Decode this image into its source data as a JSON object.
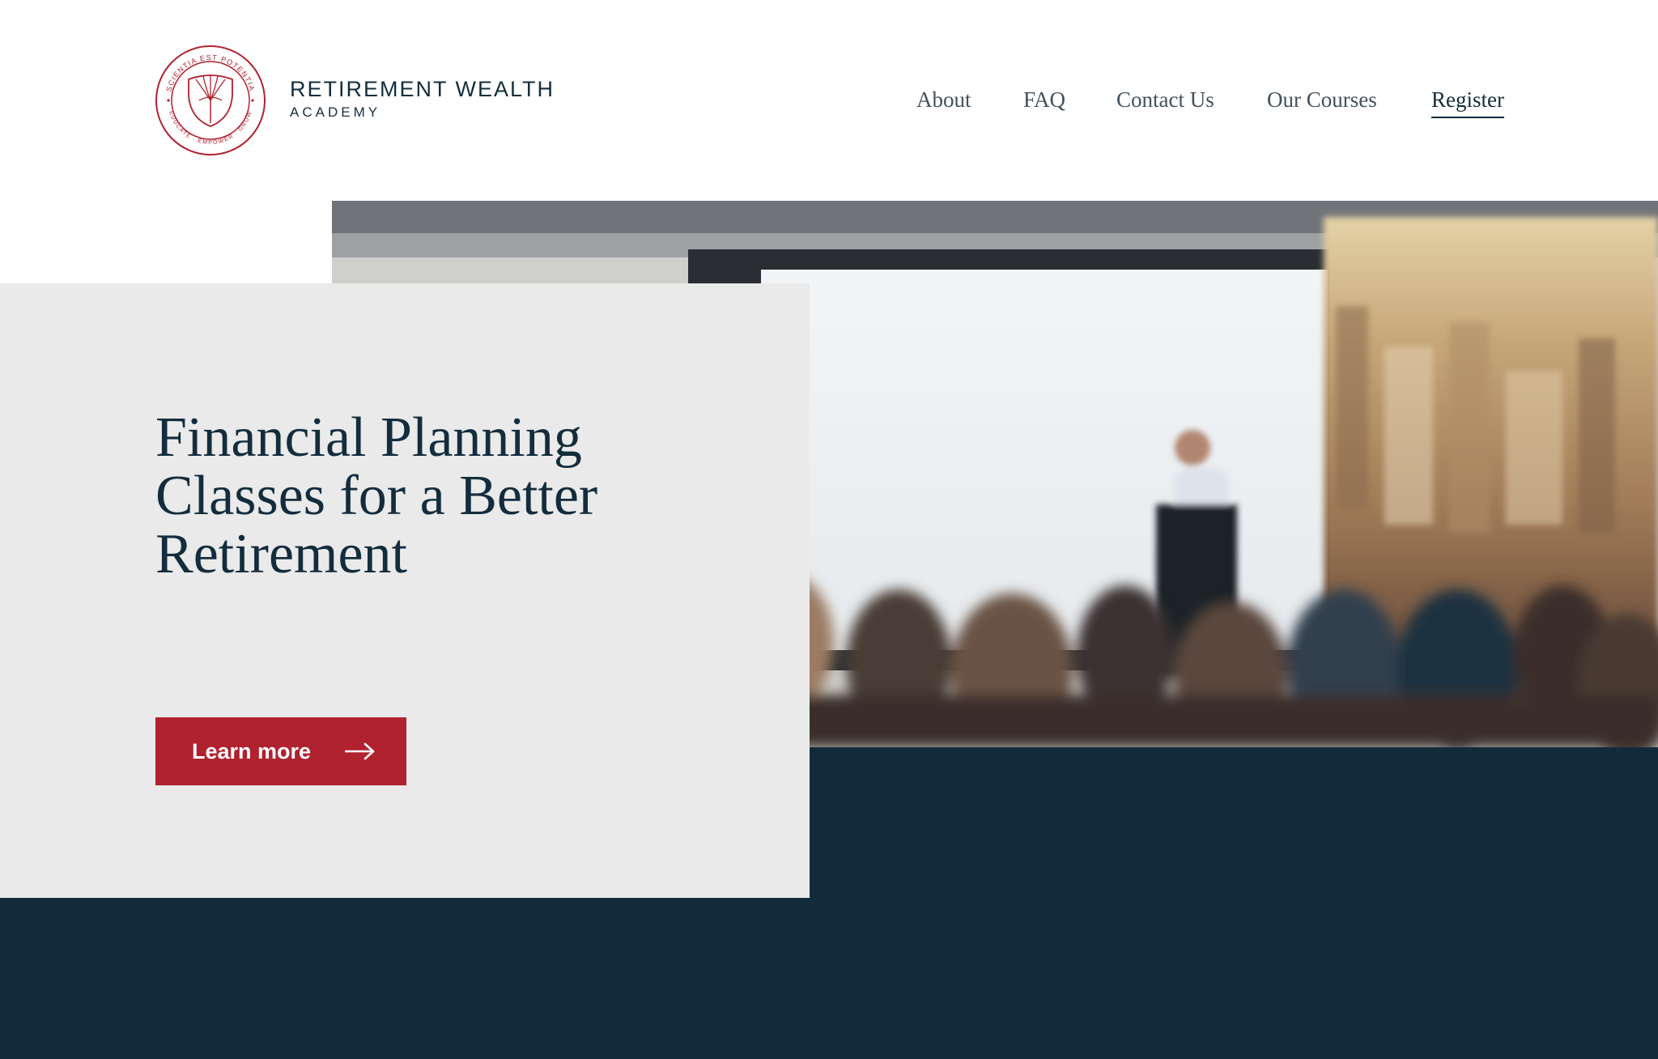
{
  "brand": {
    "name": "RETIREMENT WEALTH",
    "subtitle": "ACADEMY",
    "seal_top_text": "SCIENTIA EST POTENTIA",
    "seal_bottom_text": "EDUCATE · EMPOWER · GROW",
    "accent_color": "#b0222f"
  },
  "nav": {
    "items": [
      {
        "label": "About"
      },
      {
        "label": "FAQ"
      },
      {
        "label": "Contact Us"
      },
      {
        "label": "Our Courses"
      },
      {
        "label": "Register",
        "active": true
      }
    ]
  },
  "hero": {
    "title": "Financial Planning Classes for a Better Retirement",
    "button_label": "Learn more",
    "button_icon": "arrow-right-icon",
    "image": "conference-presentation-photo"
  },
  "colors": {
    "navy": "#112b3a",
    "card": "#eaeaea",
    "button": "#b0222f",
    "text": "#132d3d"
  }
}
